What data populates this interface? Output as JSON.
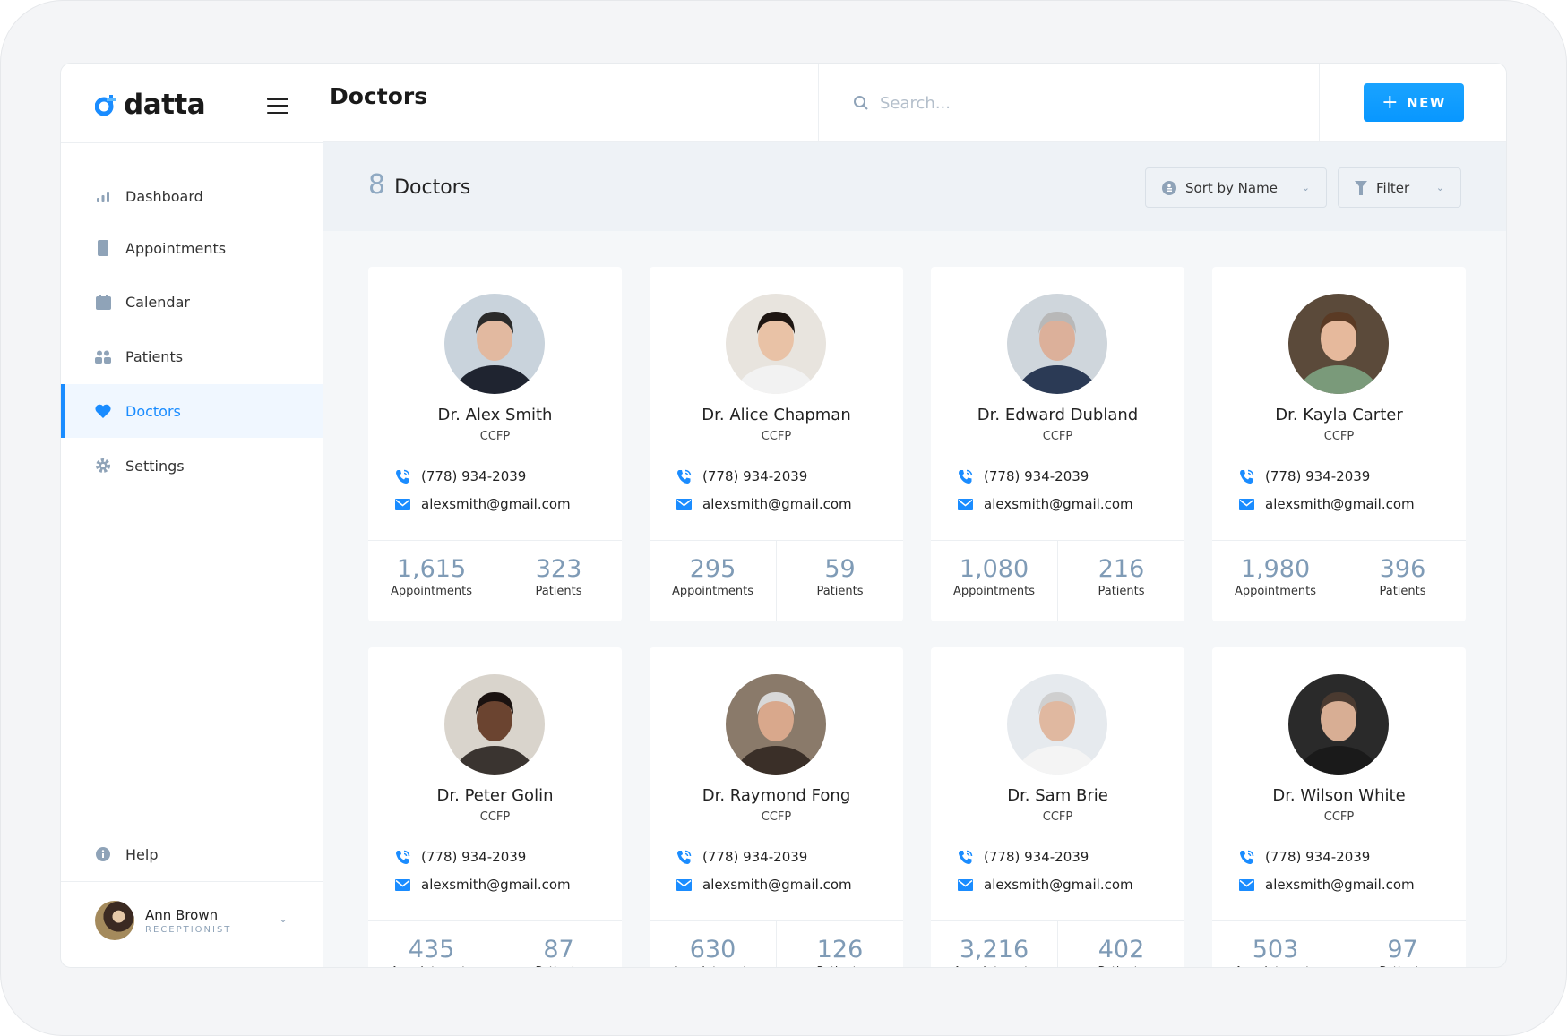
{
  "app": {
    "name": "datta",
    "accent": "#1a8cff"
  },
  "header": {
    "title": "Doctors",
    "search_placeholder": "Search...",
    "new_label": "NEW"
  },
  "sidebar": {
    "items": [
      {
        "label": "Dashboard",
        "icon": "bar-chart-icon"
      },
      {
        "label": "Appointments",
        "icon": "notebook-icon"
      },
      {
        "label": "Calendar",
        "icon": "calendar-icon"
      },
      {
        "label": "Patients",
        "icon": "users-icon"
      },
      {
        "label": "Doctors",
        "icon": "heart-icon",
        "active": true
      },
      {
        "label": "Settings",
        "icon": "gear-icon"
      }
    ],
    "help": "Help",
    "user": {
      "name": "Ann Brown",
      "role": "RECEPTIONIST"
    }
  },
  "toolbar": {
    "count": "8",
    "count_label": "Doctors",
    "sort_label": "Sort by Name",
    "filter_label": "Filter"
  },
  "stat_labels": {
    "appointments": "Appointments",
    "patients": "Patients"
  },
  "doctors": [
    {
      "name": "Dr. Alex Smith",
      "cred": "CCFP",
      "phone": "(778) 934-2039",
      "email": "alexsmith@gmail.com",
      "appointments": "1,615",
      "patients": "323"
    },
    {
      "name": "Dr. Alice Chapman",
      "cred": "CCFP",
      "phone": "(778) 934-2039",
      "email": "alexsmith@gmail.com",
      "appointments": "295",
      "patients": "59"
    },
    {
      "name": "Dr. Edward Dubland",
      "cred": "CCFP",
      "phone": "(778) 934-2039",
      "email": "alexsmith@gmail.com",
      "appointments": "1,080",
      "patients": "216"
    },
    {
      "name": "Dr. Kayla Carter",
      "cred": "CCFP",
      "phone": "(778) 934-2039",
      "email": "alexsmith@gmail.com",
      "appointments": "1,980",
      "patients": "396"
    },
    {
      "name": "Dr. Peter Golin",
      "cred": "CCFP",
      "phone": "(778) 934-2039",
      "email": "alexsmith@gmail.com",
      "appointments": "435",
      "patients": "87"
    },
    {
      "name": "Dr. Raymond Fong",
      "cred": "CCFP",
      "phone": "(778) 934-2039",
      "email": "alexsmith@gmail.com",
      "appointments": "630",
      "patients": "126"
    },
    {
      "name": "Dr. Sam Brie",
      "cred": "CCFP",
      "phone": "(778) 934-2039",
      "email": "alexsmith@gmail.com",
      "appointments": "3,216",
      "patients": "402"
    },
    {
      "name": "Dr. Wilson White",
      "cred": "CCFP",
      "phone": "(778) 934-2039",
      "email": "alexsmith@gmail.com",
      "appointments": "503",
      "patients": "97"
    }
  ]
}
